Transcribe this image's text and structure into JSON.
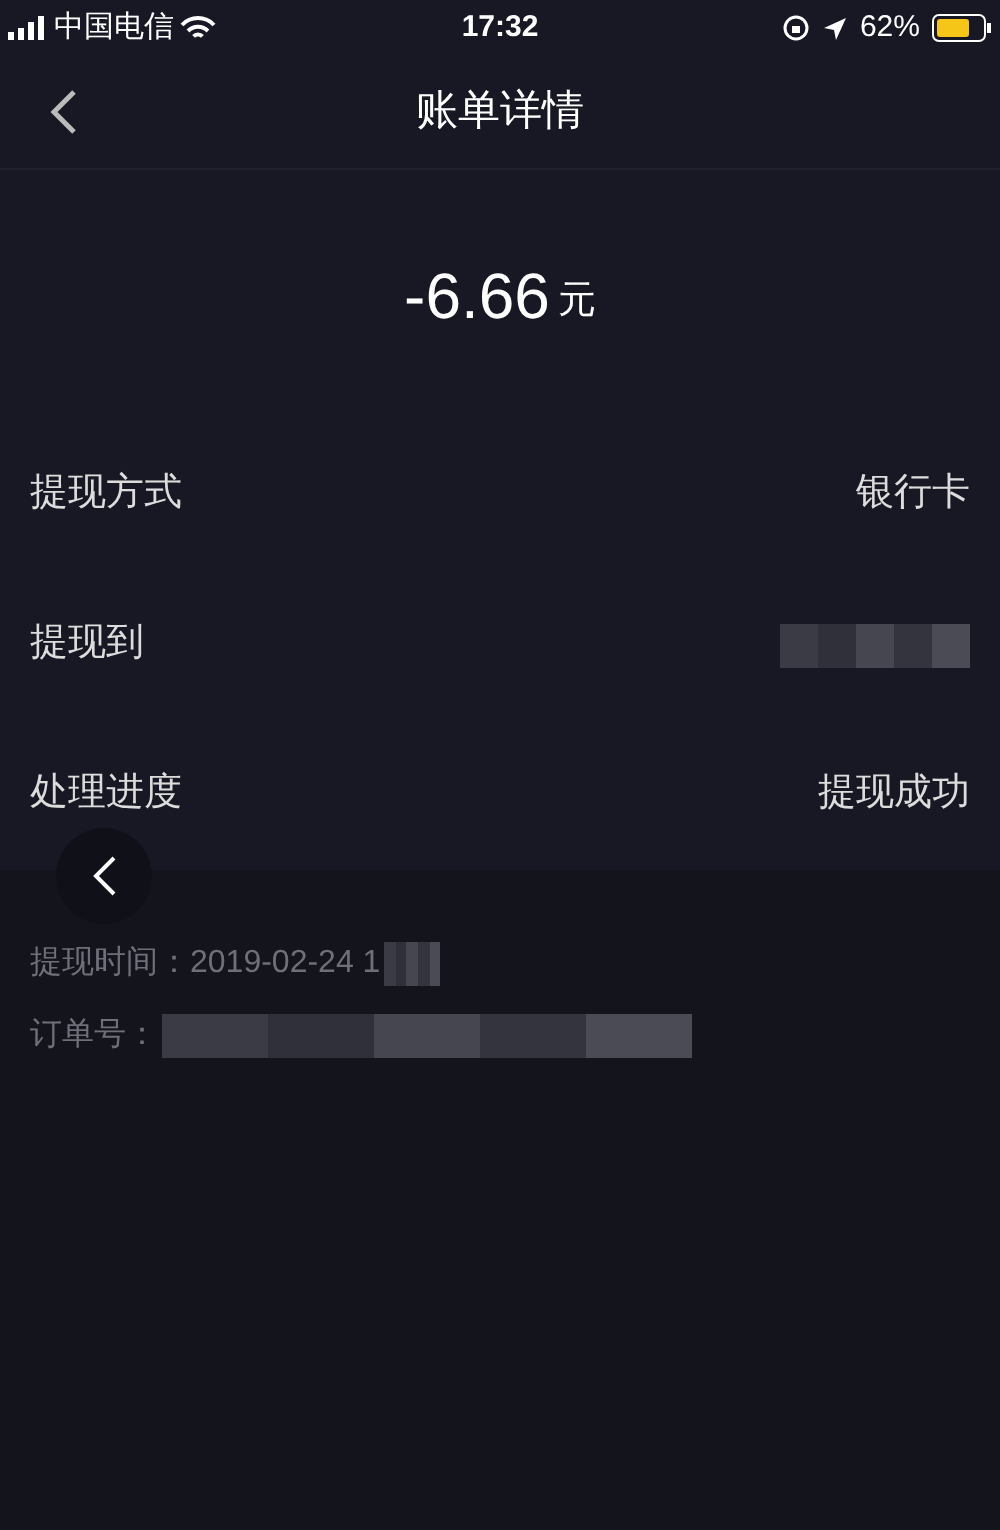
{
  "status_bar": {
    "carrier": "中国电信",
    "time": "17:32",
    "battery": "62%"
  },
  "nav": {
    "title": "账单详情"
  },
  "amount": {
    "value": "-6.66",
    "unit": "元"
  },
  "rows": [
    {
      "label": "提现方式",
      "value": "银行卡",
      "kind": "text"
    },
    {
      "label": "提现到",
      "kind": "redacted"
    },
    {
      "label": "处理进度",
      "value": "提现成功",
      "kind": "text"
    }
  ],
  "details": [
    {
      "text": "提现时间：2019-02-24 1"
    },
    {
      "text": "订单号："
    }
  ]
}
